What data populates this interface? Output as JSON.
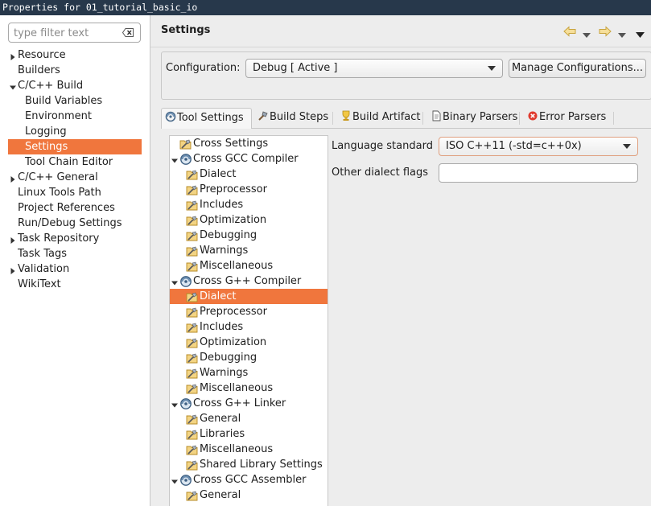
{
  "window": {
    "title": "Properties for 01_tutorial_basic_io"
  },
  "filter": {
    "placeholder": "type filter text",
    "clear_icon": "clear-icon"
  },
  "nav": [
    {
      "label": "Resource",
      "level": 0,
      "expander": "collapsed"
    },
    {
      "label": "Builders",
      "level": 0,
      "expander": "none"
    },
    {
      "label": "C/C++ Build",
      "level": 0,
      "expander": "expanded"
    },
    {
      "label": "Build Variables",
      "level": 1,
      "expander": "none"
    },
    {
      "label": "Environment",
      "level": 1,
      "expander": "none"
    },
    {
      "label": "Logging",
      "level": 1,
      "expander": "none"
    },
    {
      "label": "Settings",
      "level": 1,
      "expander": "none",
      "selected": true
    },
    {
      "label": "Tool Chain Editor",
      "level": 1,
      "expander": "none"
    },
    {
      "label": "C/C++ General",
      "level": 0,
      "expander": "collapsed"
    },
    {
      "label": "Linux Tools Path",
      "level": 0,
      "expander": "none"
    },
    {
      "label": "Project References",
      "level": 0,
      "expander": "none"
    },
    {
      "label": "Run/Debug Settings",
      "level": 0,
      "expander": "none"
    },
    {
      "label": "Task Repository",
      "level": 0,
      "expander": "collapsed"
    },
    {
      "label": "Task Tags",
      "level": 0,
      "expander": "none"
    },
    {
      "label": "Validation",
      "level": 0,
      "expander": "collapsed"
    },
    {
      "label": "WikiText",
      "level": 0,
      "expander": "none"
    }
  ],
  "page": {
    "heading": "Settings",
    "nav_icons": [
      "back-arrow-icon",
      "dropdown-icon",
      "forward-arrow-icon",
      "dropdown-icon",
      "view-menu-icon"
    ]
  },
  "config": {
    "label": "Configuration:",
    "value": "Debug  [ Active ]",
    "manage_button": "Manage Configurations..."
  },
  "tabs": [
    {
      "label": "Tool Settings",
      "icon": "tool-settings-icon",
      "active": true
    },
    {
      "label": "Build Steps",
      "icon": "build-steps-icon"
    },
    {
      "label": "Build Artifact",
      "icon": "build-artifact-icon"
    },
    {
      "label": "Binary Parsers",
      "icon": "binary-parsers-icon"
    },
    {
      "label": "Error Parsers",
      "icon": "error-parsers-icon"
    }
  ],
  "tool_tree": [
    {
      "label": "Cross Settings",
      "type": "option",
      "level": 0
    },
    {
      "label": "Cross GCC Compiler",
      "type": "tool",
      "level": 0,
      "expander": "expanded"
    },
    {
      "label": "Dialect",
      "type": "option",
      "level": 1
    },
    {
      "label": "Preprocessor",
      "type": "option",
      "level": 1
    },
    {
      "label": "Includes",
      "type": "option",
      "level": 1
    },
    {
      "label": "Optimization",
      "type": "option",
      "level": 1
    },
    {
      "label": "Debugging",
      "type": "option",
      "level": 1
    },
    {
      "label": "Warnings",
      "type": "option",
      "level": 1
    },
    {
      "label": "Miscellaneous",
      "type": "option",
      "level": 1
    },
    {
      "label": "Cross G++ Compiler",
      "type": "tool",
      "level": 0,
      "expander": "expanded"
    },
    {
      "label": "Dialect",
      "type": "option",
      "level": 1,
      "selected": true
    },
    {
      "label": "Preprocessor",
      "type": "option",
      "level": 1
    },
    {
      "label": "Includes",
      "type": "option",
      "level": 1
    },
    {
      "label": "Optimization",
      "type": "option",
      "level": 1
    },
    {
      "label": "Debugging",
      "type": "option",
      "level": 1
    },
    {
      "label": "Warnings",
      "type": "option",
      "level": 1
    },
    {
      "label": "Miscellaneous",
      "type": "option",
      "level": 1
    },
    {
      "label": "Cross G++ Linker",
      "type": "tool",
      "level": 0,
      "expander": "expanded"
    },
    {
      "label": "General",
      "type": "option",
      "level": 1
    },
    {
      "label": "Libraries",
      "type": "option",
      "level": 1
    },
    {
      "label": "Miscellaneous",
      "type": "option",
      "level": 1
    },
    {
      "label": "Shared Library Settings",
      "type": "option",
      "level": 1
    },
    {
      "label": "Cross GCC Assembler",
      "type": "tool",
      "level": 0,
      "expander": "expanded"
    },
    {
      "label": "General",
      "type": "option",
      "level": 1
    }
  ],
  "form": {
    "language_standard_label": "Language standard",
    "language_standard_value": "ISO C++11 (-std=c++0x)",
    "other_flags_label": "Other dialect flags",
    "other_flags_value": ""
  },
  "colors": {
    "selection": "#f0763d",
    "titlebar": "#27384b"
  }
}
